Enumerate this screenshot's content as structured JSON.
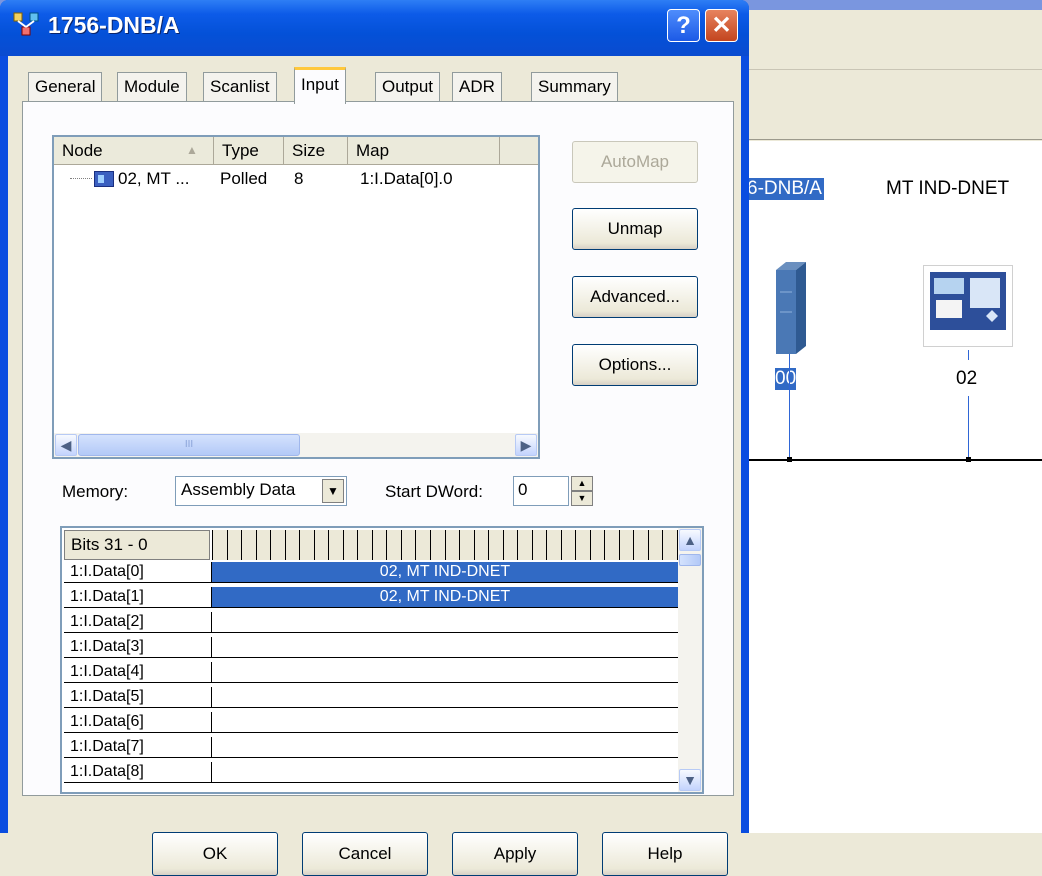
{
  "window": {
    "title": "1756-DNB/A"
  },
  "tabs": [
    {
      "label": "General"
    },
    {
      "label": "Module"
    },
    {
      "label": "Scanlist"
    },
    {
      "label": "Input"
    },
    {
      "label": "Output"
    },
    {
      "label": "ADR"
    },
    {
      "label": "Summary"
    }
  ],
  "active_tab": "Input",
  "listview": {
    "columns": [
      "Node",
      "Type",
      "Size",
      "Map"
    ],
    "rows": [
      {
        "node": "02, MT ...",
        "type": "Polled",
        "size": "8",
        "map": "1:I.Data[0].0"
      }
    ],
    "scroll_glyph": "III"
  },
  "buttons": {
    "automap": "AutoMap",
    "unmap": "Unmap",
    "advanced": "Advanced...",
    "options": "Options...",
    "ok": "OK",
    "cancel": "Cancel",
    "apply": "Apply",
    "help": "Help"
  },
  "memory": {
    "label": "Memory:",
    "value": "Assembly Data"
  },
  "start_dword": {
    "label": "Start DWord:",
    "value": "0"
  },
  "bits": {
    "header": "Bits 31 - 0",
    "rows": [
      {
        "label": "1:I.Data[0]",
        "value": "02, MT IND-DNET",
        "mapped": true
      },
      {
        "label": "1:I.Data[1]",
        "value": "02, MT IND-DNET",
        "mapped": true
      },
      {
        "label": "1:I.Data[2]",
        "value": "",
        "mapped": false
      },
      {
        "label": "1:I.Data[3]",
        "value": "",
        "mapped": false
      },
      {
        "label": "1:I.Data[4]",
        "value": "",
        "mapped": false
      },
      {
        "label": "1:I.Data[5]",
        "value": "",
        "mapped": false
      },
      {
        "label": "1:I.Data[6]",
        "value": "",
        "mapped": false
      },
      {
        "label": "1:I.Data[7]",
        "value": "",
        "mapped": false
      },
      {
        "label": "1:I.Data[8]",
        "value": "",
        "mapped": false
      }
    ]
  },
  "background": {
    "scanner_label": "6-DNB/A",
    "device_label": "MT IND-DNET",
    "scanner_node": "00",
    "device_node": "02"
  },
  "colors": {
    "title_bar": "#0a4de0",
    "selection": "#316ac5",
    "dialog_face": "#ece9d8"
  }
}
